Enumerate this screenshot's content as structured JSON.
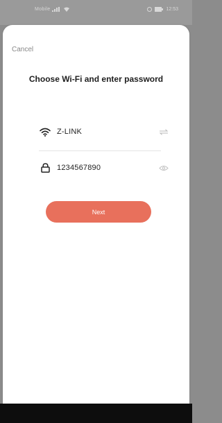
{
  "status_bar": {
    "carrier": "Mobile",
    "time": "12:53"
  },
  "header": {
    "cancel_label": "Cancel",
    "title": "Choose Wi-Fi and enter password"
  },
  "wifi": {
    "icon": "wifi-icon",
    "ssid": "Z-LINK",
    "action_icon": "switch-network-icon"
  },
  "password": {
    "icon": "lock-icon",
    "value": "1234567890",
    "action_icon": "eye-icon"
  },
  "next_button": {
    "label": "Next"
  },
  "colors": {
    "accent": "#e8705c",
    "text": "#1e1e1e",
    "muted": "#888888"
  }
}
